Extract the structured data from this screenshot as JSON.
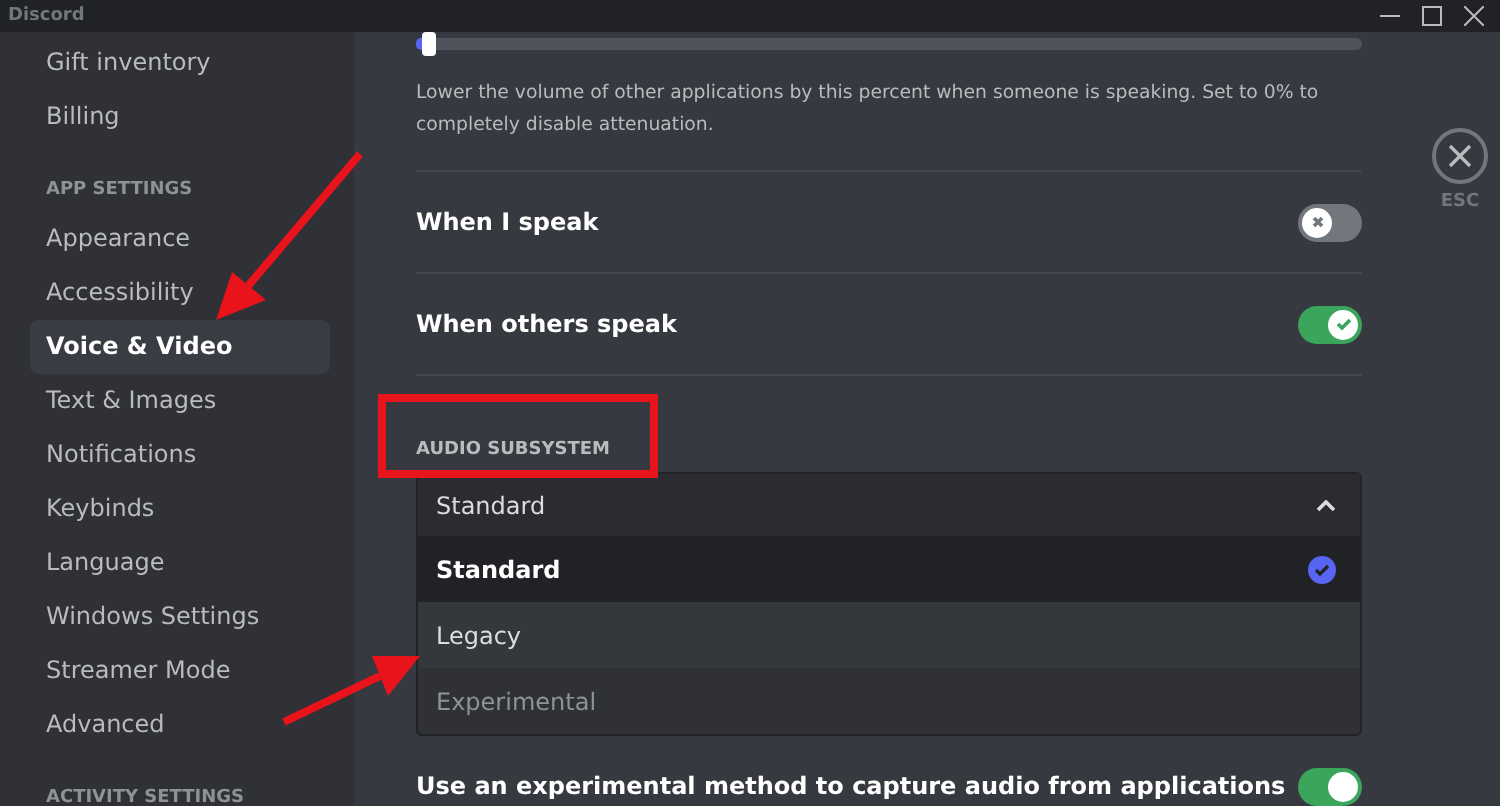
{
  "window": {
    "title": "Discord"
  },
  "sidebar": {
    "items": [
      {
        "kind": "item",
        "label": "Gift inventory",
        "selected": false
      },
      {
        "kind": "item",
        "label": "Billing",
        "selected": false
      },
      {
        "kind": "header",
        "label": "APP SETTINGS"
      },
      {
        "kind": "item",
        "label": "Appearance",
        "selected": false
      },
      {
        "kind": "item",
        "label": "Accessibility",
        "selected": false
      },
      {
        "kind": "item",
        "label": "Voice & Video",
        "selected": true
      },
      {
        "kind": "item",
        "label": "Text & Images",
        "selected": false
      },
      {
        "kind": "item",
        "label": "Notifications",
        "selected": false
      },
      {
        "kind": "item",
        "label": "Keybinds",
        "selected": false
      },
      {
        "kind": "item",
        "label": "Language",
        "selected": false
      },
      {
        "kind": "item",
        "label": "Windows Settings",
        "selected": false
      },
      {
        "kind": "item",
        "label": "Streamer Mode",
        "selected": false
      },
      {
        "kind": "item",
        "label": "Advanced",
        "selected": false
      },
      {
        "kind": "header",
        "label": "ACTIVITY SETTINGS"
      }
    ]
  },
  "attenuation": {
    "level": 0.01,
    "description": "Lower the volume of other applications by this percent when someone is speaking. Set to 0% to completely disable attenuation."
  },
  "toggles": [
    {
      "label": "When I speak",
      "on": false
    },
    {
      "label": "When others speak",
      "on": true
    }
  ],
  "audio_subsystem": {
    "header": "AUDIO SUBSYSTEM",
    "value": "Standard",
    "expanded": true,
    "options": [
      {
        "label": "Standard",
        "selected": true,
        "hovered": false
      },
      {
        "label": "Legacy",
        "selected": false,
        "hovered": true
      },
      {
        "label": "Experimental",
        "selected": false,
        "hovered": false
      }
    ]
  },
  "capture": {
    "label": "Use an experimental method to capture audio from applications",
    "on": true
  },
  "close": {
    "label": "ESC"
  }
}
